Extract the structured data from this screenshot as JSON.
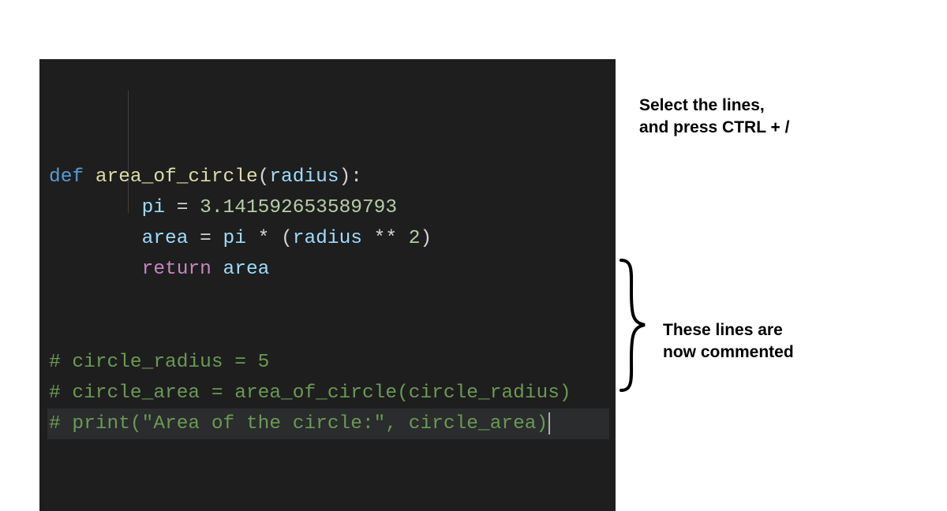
{
  "code": {
    "line1": {
      "def": "def ",
      "fn": "area_of_circle",
      "open": "(",
      "param": "radius",
      "close": "):"
    },
    "line2": {
      "indent": "        ",
      "var": "pi",
      "eq": " = ",
      "num": "3.141592653589793"
    },
    "line3": {
      "indent": "        ",
      "var": "area",
      "eq": " = ",
      "v2": "pi",
      "op1": " * (",
      "v3": "radius",
      "op2": " ** ",
      "num": "2",
      "close": ")"
    },
    "line4": {
      "indent": "        ",
      "ret": "return ",
      "var": "area"
    },
    "line5": " ",
    "line6": " ",
    "line7": "# circle_radius = 5",
    "line8": "# circle_area = area_of_circle(circle_radius)",
    "line9": "# print(\"Area of the circle:\", circle_area)"
  },
  "annotations": {
    "top_line1": "Select the lines,",
    "top_line2": "and press CTRL + /",
    "bottom_line1": "These lines are",
    "bottom_line2": "now commented"
  }
}
